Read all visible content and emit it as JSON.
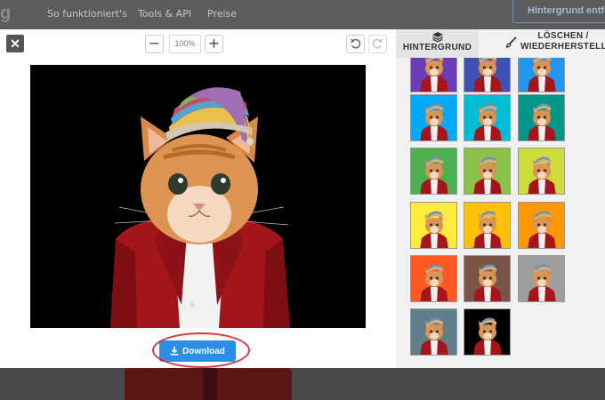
{
  "topnav": {
    "logo": "g",
    "links": [
      "So funktioniert's",
      "Tools & API",
      "Preise"
    ],
    "cta_label": "Hintergrund entfe"
  },
  "editor": {
    "zoom_out": "−",
    "zoom_level": "100%",
    "zoom_in": "+",
    "close": "✕",
    "download_label": "Download"
  },
  "sidebar": {
    "tabs": [
      {
        "label": "HINTERGRUND",
        "icon": "layers-icon",
        "active": true
      },
      {
        "label": "LÖSCHEN / WIEDERHERSTELLEN",
        "icon": "brush-icon",
        "active": false
      }
    ],
    "swatches": [
      "#6a3fb5",
      "#3f51b5",
      "#2196f3",
      "#03a9f4",
      "#00bcd4",
      "#009688",
      "#4caf50",
      "#8bc34a",
      "#cddc39",
      "#ffeb3b",
      "#ffc107",
      "#ff9800",
      "#ff5722",
      "#795548",
      "#9e9e9e",
      "#607d8b",
      "#000000"
    ]
  },
  "colors": {
    "accent": "#2d8ee6",
    "highlight": "#d63a3f"
  }
}
